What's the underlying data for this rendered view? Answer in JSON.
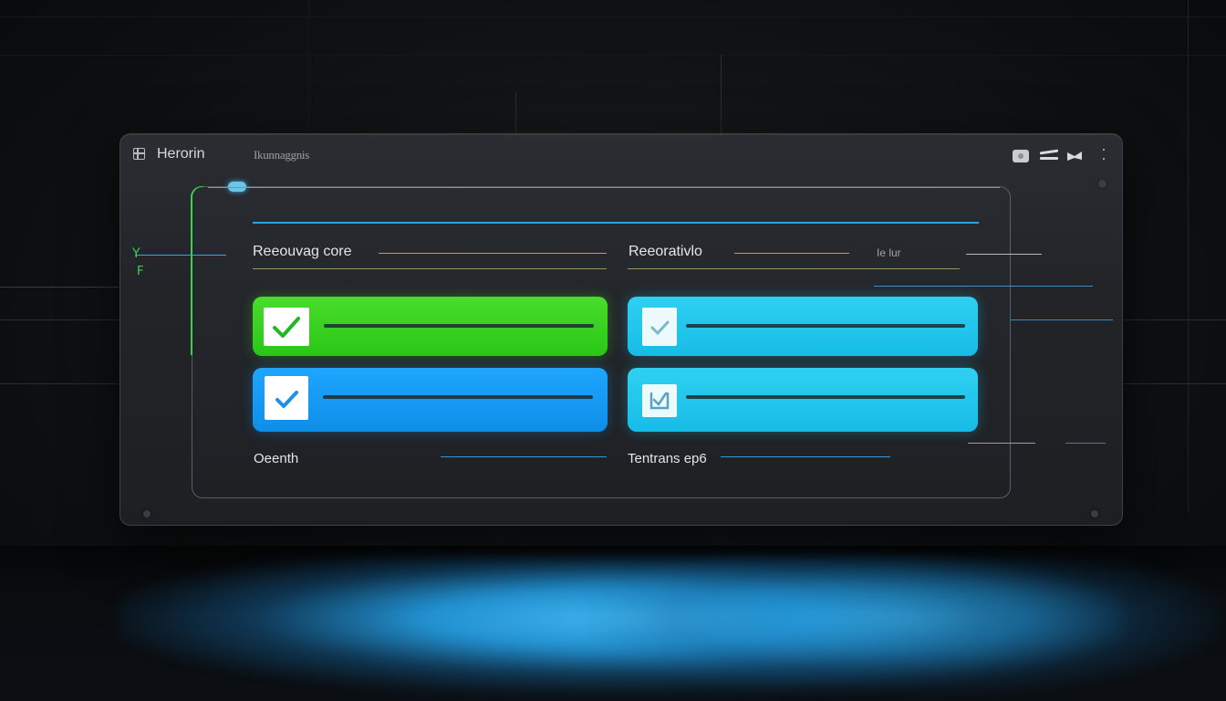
{
  "window": {
    "title": "Herorin",
    "tab": "Ikunnaggnis"
  },
  "sections": {
    "left_header": "Reeouvag core",
    "right_header": "Reeorativlo",
    "right_badge": "Ie lur",
    "left_footer": "Oeenth",
    "right_footer": "Tentrans ep6"
  },
  "side_marks": {
    "top": "Y",
    "bottom": "F"
  },
  "tasks": [
    {
      "state": "checked",
      "color": "#38d420"
    },
    {
      "state": "pending",
      "color": "#1ab5ee"
    },
    {
      "state": "checked",
      "color": "#1598f2"
    },
    {
      "state": "pending",
      "color": "#1ab5ee"
    }
  ],
  "icons": {
    "window_menu": "grid-icon",
    "ctrl_1": "record-icon",
    "ctrl_2": "minimize-icon",
    "ctrl_3": "flag-icon",
    "ctrl_4": "more-icon"
  }
}
